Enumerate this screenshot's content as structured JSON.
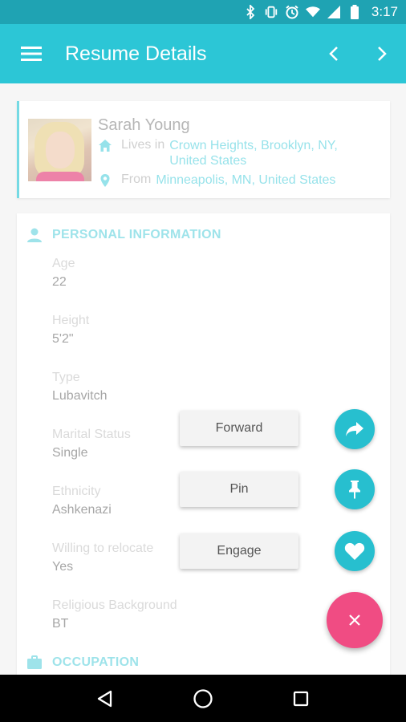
{
  "status_bar": {
    "time": "3:17",
    "icons": [
      "bluetooth-icon",
      "vibrate-icon",
      "alarm-icon",
      "wifi-icon",
      "signal-icon",
      "battery-icon"
    ]
  },
  "app_bar": {
    "title": "Resume Details",
    "menu_icon": "hamburger-menu-icon",
    "prev_icon": "chevron-left-icon",
    "next_icon": "chevron-right-icon"
  },
  "profile": {
    "name": "Sarah Young",
    "lives_label": "Lives in",
    "lives_value": "Crown Heights, Brooklyn, NY, United States",
    "from_label": "From",
    "from_value": "Minneapolis, MN, United States"
  },
  "personal_information": {
    "title": "PERSONAL INFORMATION",
    "fields": [
      {
        "label": "Age",
        "value": "22"
      },
      {
        "label": "Height",
        "value": "5'2\""
      },
      {
        "label": "Type",
        "value": "Lubavitch"
      },
      {
        "label": "Marital Status",
        "value": "Single"
      },
      {
        "label": "Ethnicity",
        "value": "Ashkenazi"
      },
      {
        "label": "Willing to relocate",
        "value": "Yes"
      },
      {
        "label": "Religious Background",
        "value": "BT"
      }
    ]
  },
  "occupation": {
    "title": "OCCUPATION"
  },
  "fab_menu": {
    "actions": [
      {
        "label": "Forward",
        "icon": "share-arrow-icon"
      },
      {
        "label": "Pin",
        "icon": "pin-icon"
      },
      {
        "label": "Engage",
        "icon": "heart-icon"
      }
    ],
    "close_icon": "close-icon"
  },
  "colors": {
    "primary": "#2cc6d6",
    "primary_dark": "#1fa3b3",
    "accent": "#f04c83",
    "link": "#5fd3df"
  }
}
